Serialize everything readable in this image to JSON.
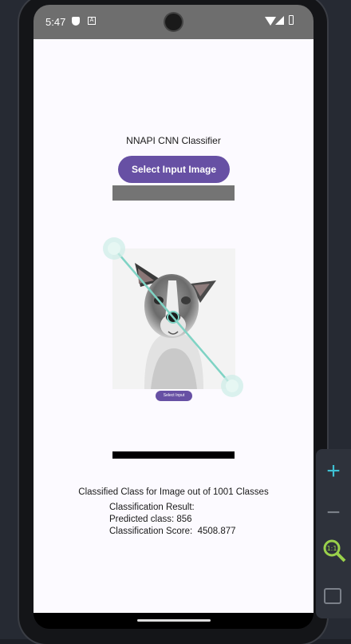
{
  "status_bar": {
    "time": "5:47",
    "icon_left_1": "shield-icon",
    "icon_left_2": "a-icon",
    "icon_right": [
      "wifi-icon",
      "signal-icon",
      "battery-icon"
    ]
  },
  "app": {
    "title": "NNAPI CNN Classifier",
    "select_button_label": "Select Input Image",
    "preview_small_button_label": "Select Input",
    "image_subject": "dog-photo",
    "results": {
      "heading": "Classified Class for Image out of 1001 Classes",
      "line1": "Classification Result:",
      "line2": "Predicted class: 856",
      "line3": "Classification Score:  4508.877"
    }
  },
  "emulator_panel": {
    "items": [
      "zoom-in-icon",
      "zoom-out-icon",
      "zoom-1to1-icon",
      "fit-screen-icon"
    ]
  },
  "colors": {
    "accent": "#6750a4",
    "status_bar": "#6e6e6e",
    "app_background": "#fcfaff",
    "gesture_overlay": "#7fd3c4"
  }
}
